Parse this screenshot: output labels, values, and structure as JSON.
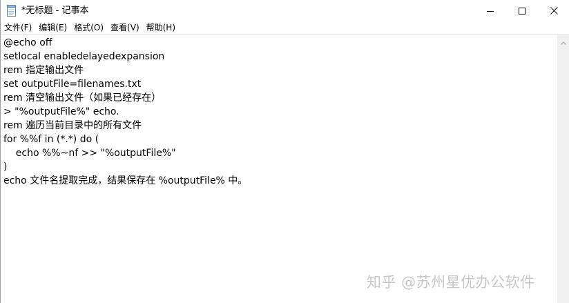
{
  "window": {
    "title": "*无标题 - 记事本",
    "app_icon": "notepad-icon",
    "controls": {
      "minimize_icon": "minimize-icon",
      "maximize_icon": "maximize-icon",
      "close_icon": "close-icon"
    }
  },
  "menu": {
    "items": [
      {
        "label": "文件(F)"
      },
      {
        "label": "编辑(E)"
      },
      {
        "label": "格式(O)"
      },
      {
        "label": "查看(V)"
      },
      {
        "label": "帮助(H)"
      }
    ]
  },
  "editor": {
    "lines": [
      "@echo off",
      "setlocal enabledelayedexpansion",
      "rem 指定输出文件",
      "set outputFile=filenames.txt",
      "rem 清空输出文件（如果已经存在）",
      "> \"%outputFile%\" echo.",
      "rem 遍历当前目录中的所有文件",
      "for %%f in (*.*) do (",
      "    echo %%~nf >> \"%outputFile%\"",
      ")",
      "echo 文件名提取完成，结果保存在 %outputFile% 中。"
    ]
  },
  "watermark": {
    "text": "知乎 @苏州星优办公软件"
  },
  "colors": {
    "background": "#ffffff",
    "scrollbar": "#f0f0f0",
    "watermark": "#c8c8c8",
    "text": "#000000"
  }
}
